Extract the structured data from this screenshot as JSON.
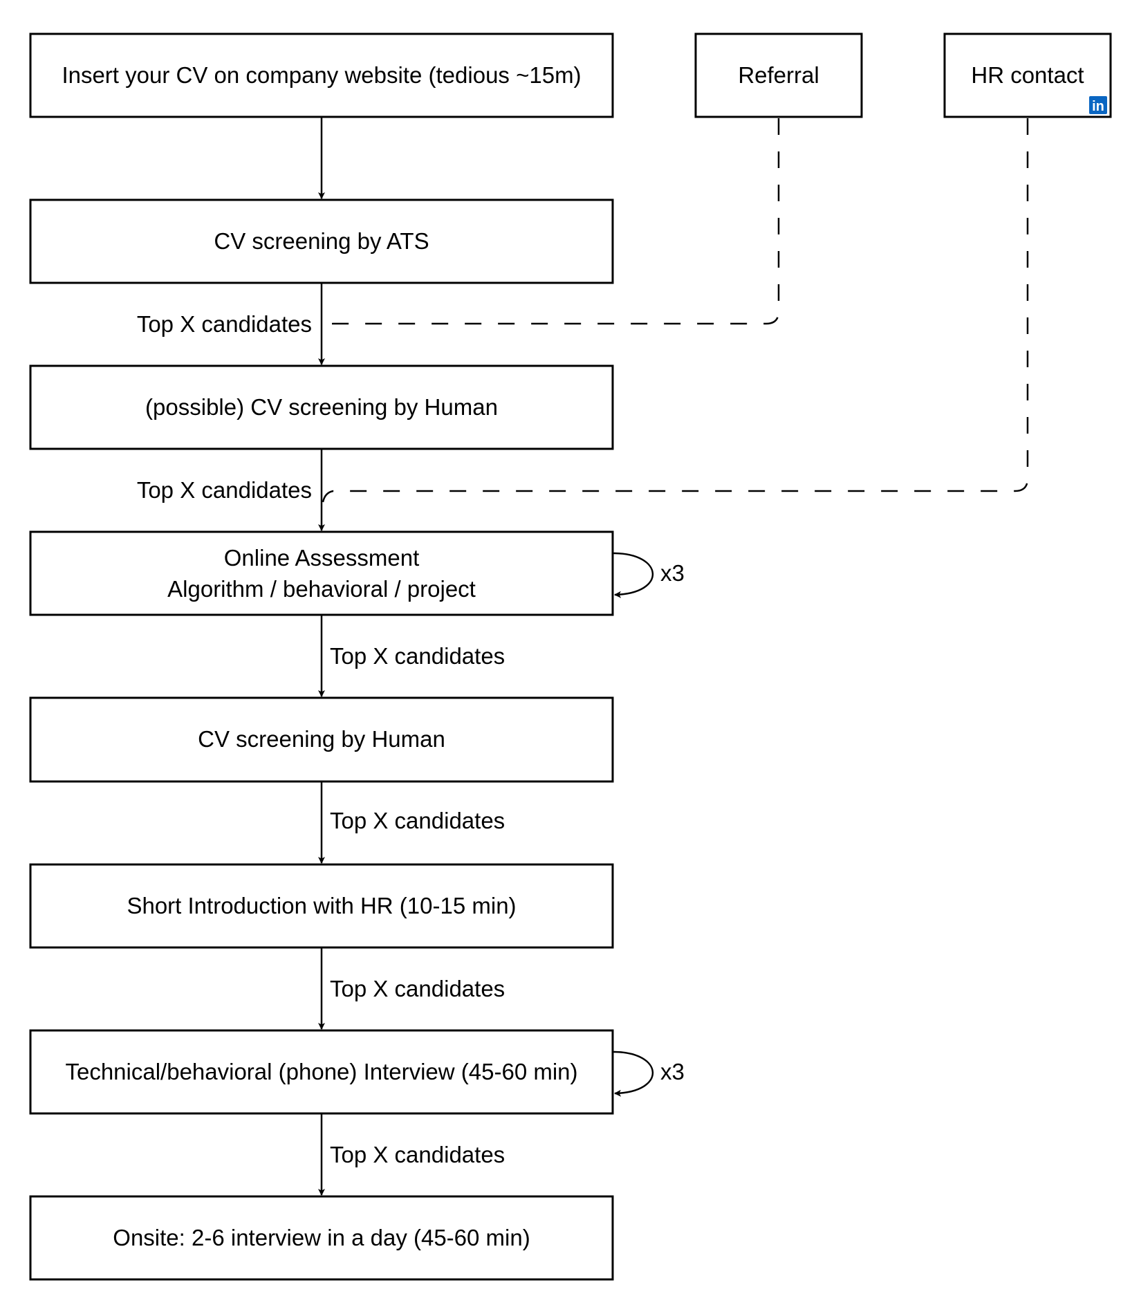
{
  "nodes": {
    "apply": "Insert your CV on company website (tedious ~15m)",
    "referral": "Referral",
    "hr_contact": "HR contact",
    "ats": "CV screening by ATS",
    "possible_human": "(possible) CV screening by Human",
    "assessment_line1": "Online Assessment",
    "assessment_line2": "Algorithm / behavioral / project",
    "human": "CV screening by Human",
    "hr_intro": "Short Introduction with HR (10-15 min)",
    "phone": "Technical/behavioral (phone) Interview (45-60 min)",
    "onsite": "Onsite: 2-6 interview in a day (45-60 min)"
  },
  "edge_labels": {
    "ats_to_possible": "Top X candidates",
    "possible_to_assessment": "Top X candidates",
    "assessment_to_human": "Top X candidates",
    "human_to_intro": "Top X candidates",
    "intro_to_phone": "Top X candidates",
    "phone_to_onsite": "Top X candidates"
  },
  "loops": {
    "assessment_repeat": "x3",
    "phone_repeat": "x3"
  },
  "icons": {
    "hr_contact_badge": "linkedin-icon",
    "linkedin_glyph": "in"
  },
  "colors": {
    "linkedin": "#0A66C2"
  }
}
